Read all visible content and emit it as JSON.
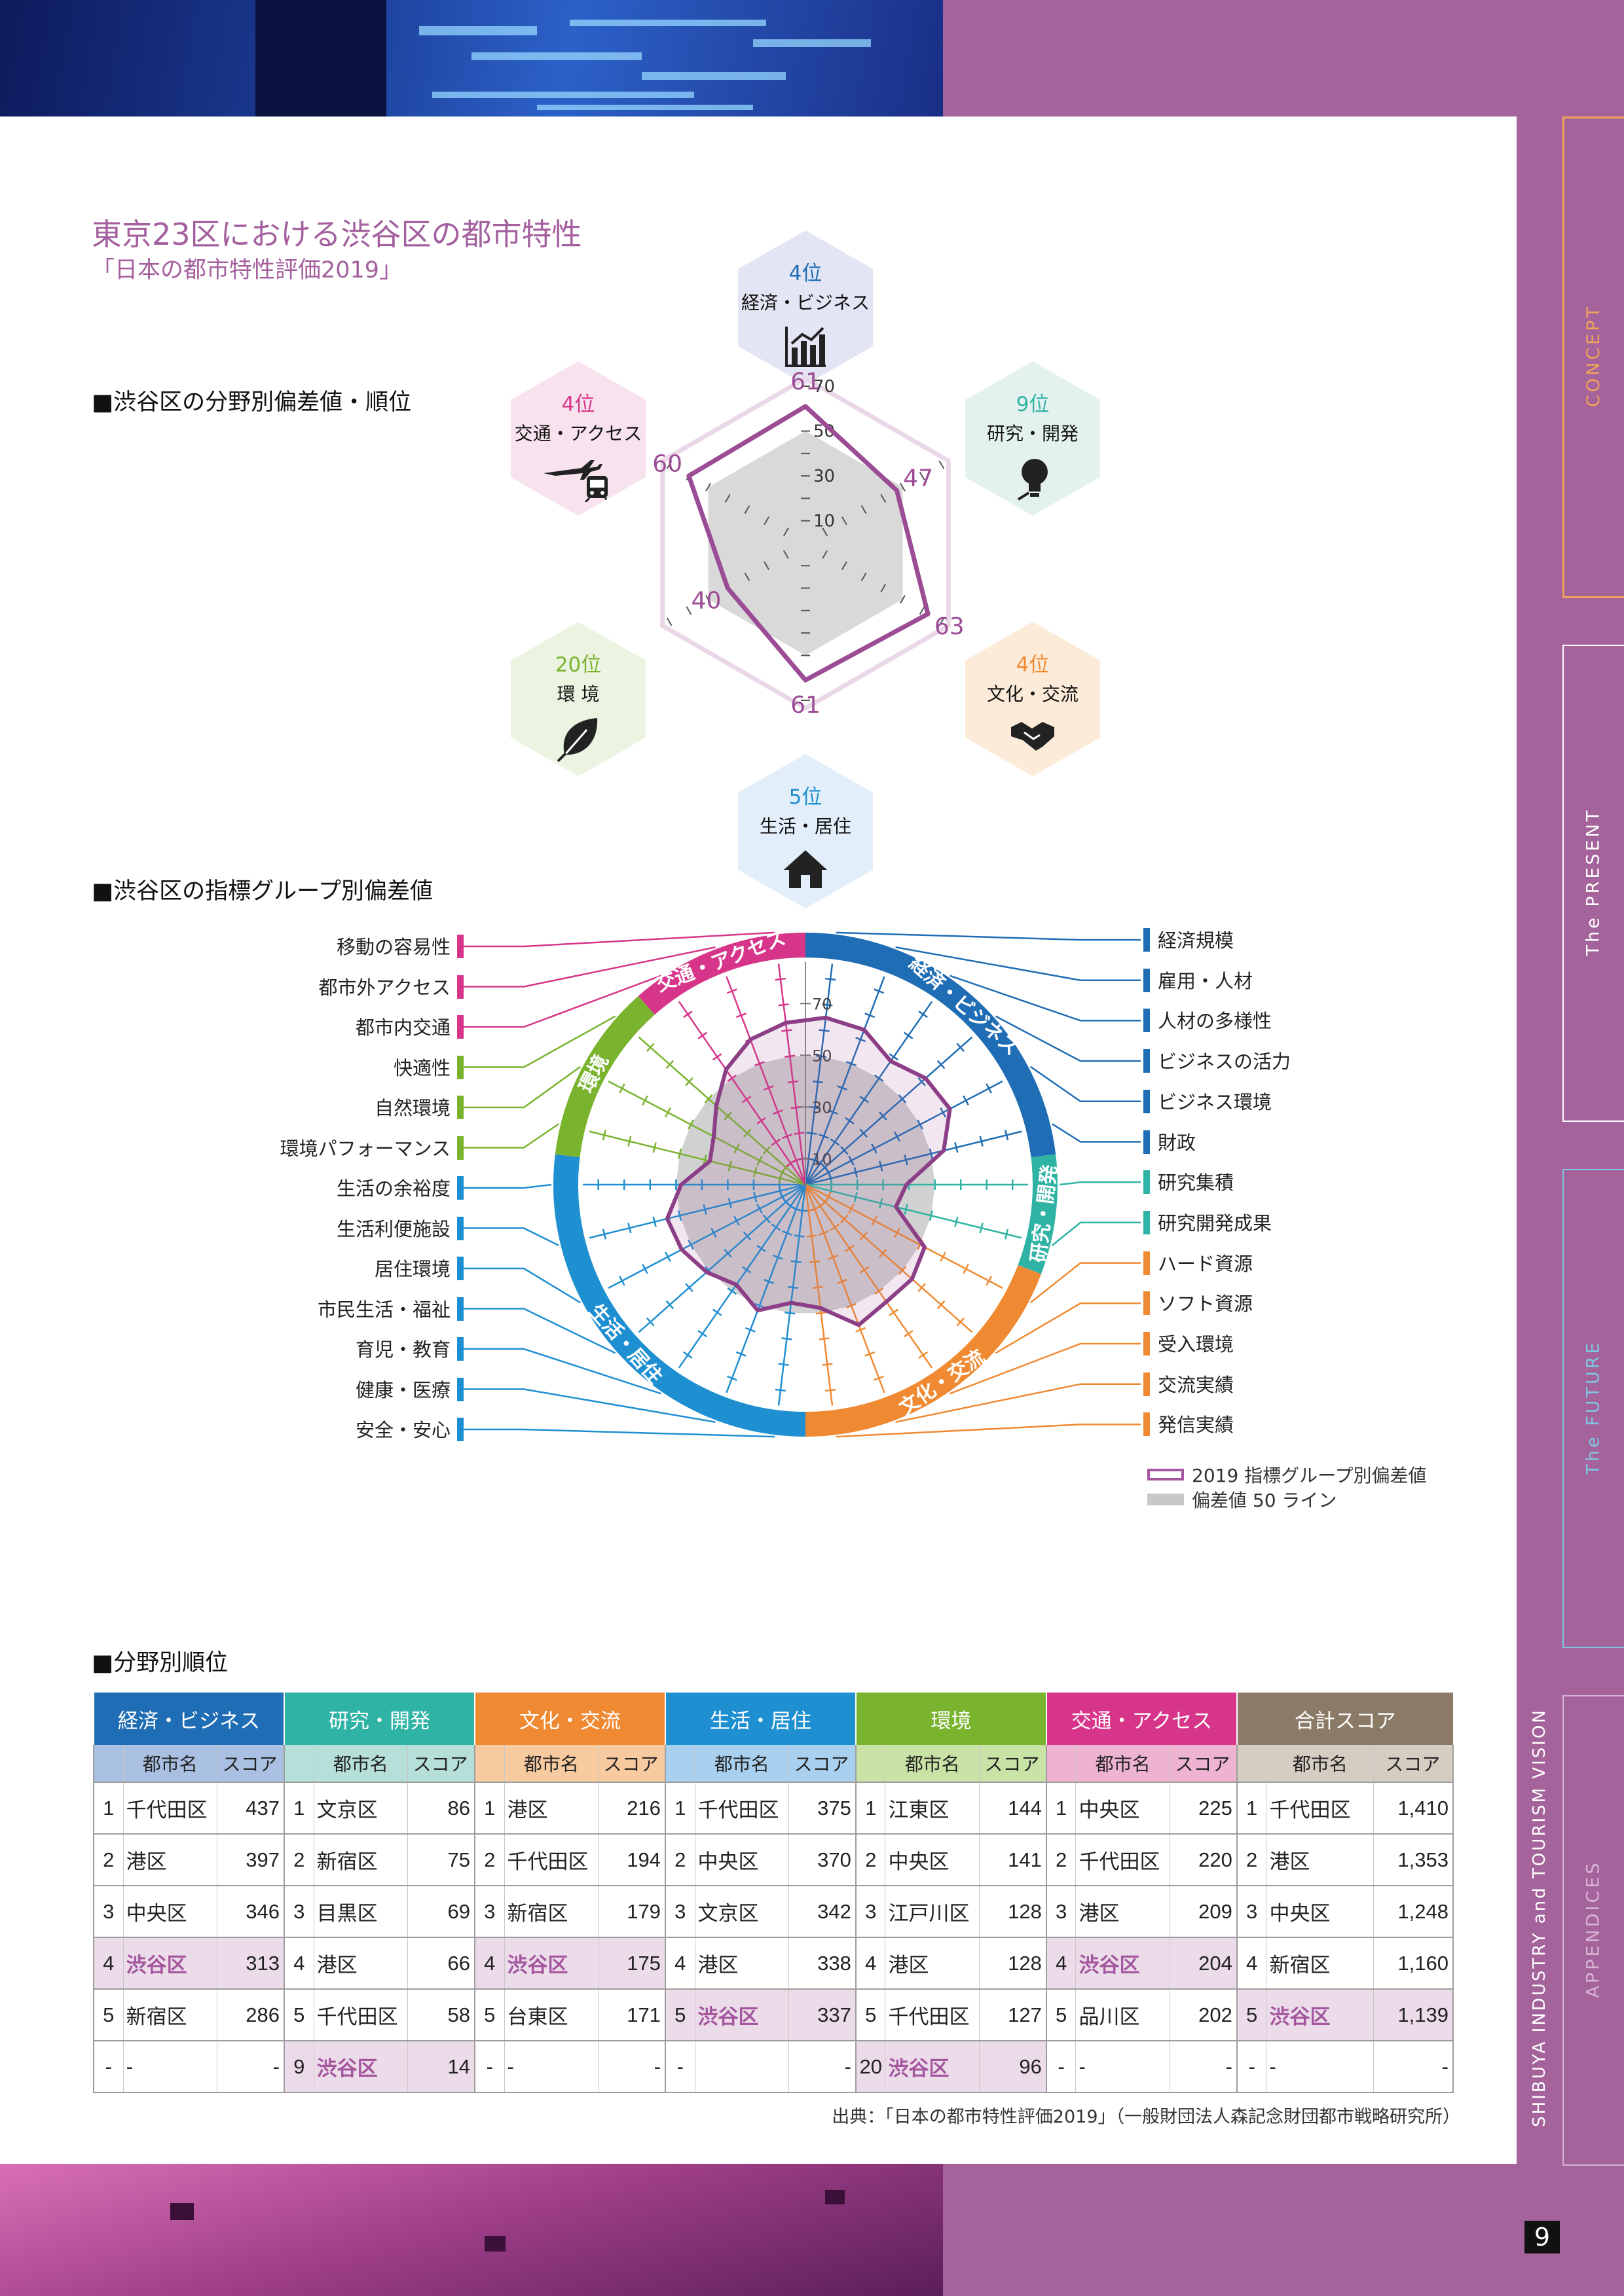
{
  "page": {
    "title": "東京23区における渋谷区の都市特性",
    "subtitle": "「日本の都市特性評価2019」",
    "page_number": "9",
    "vertical_text": "SHIBUYA INDUSTRY and TOURISM VISION",
    "source": "出典：「日本の都市特性評価2019」（一般財団法人森記念財団都市戦略研究所）"
  },
  "side_tabs": [
    {
      "label": "CONCEPT",
      "color": "#f0a35a"
    },
    {
      "label": "The PRESENT",
      "color": "#ffffff"
    },
    {
      "label": "The FUTURE",
      "color": "#7fc6e2"
    },
    {
      "label": "APPENDICES",
      "color": "#d8b4d4"
    }
  ],
  "section1": {
    "heading": "■渋谷区の分野別偏差値・順位",
    "categories": [
      {
        "rank": "4位",
        "label": "経済・ビジネス",
        "color": "#1f6db4",
        "bg": "#e4e5f4",
        "icon": "chart-icon"
      },
      {
        "rank": "9位",
        "label": "研究・開発",
        "color": "#2fb3a4",
        "bg": "#e4f2ef",
        "icon": "lightbulb-icon"
      },
      {
        "rank": "4位",
        "label": "文化・交流",
        "color": "#ef8a32",
        "bg": "#fdebd9",
        "icon": "handshake-icon"
      },
      {
        "rank": "5位",
        "label": "生活・居住",
        "color": "#1e8fd1",
        "bg": "#e2eef9",
        "icon": "house-icon"
      },
      {
        "rank": "20位",
        "label": "環 境",
        "color": "#7ab32e",
        "bg": "#ebf4e1",
        "icon": "leaf-icon"
      },
      {
        "rank": "4位",
        "label": "交通・アクセス",
        "color": "#d7358a",
        "bg": "#f7e2ed",
        "icon": "plane-train-icon"
      }
    ]
  },
  "chart_data": [
    {
      "type": "radar",
      "axes": [
        "経済・ビジネス",
        "研究・開発",
        "文化・交流",
        "生活・居住",
        "環 境",
        "交通・アクセス"
      ],
      "values": [
        61,
        47,
        63,
        61,
        40,
        60
      ],
      "ticks": [
        "10",
        "30",
        "50",
        "70"
      ],
      "value_labels": [
        "61",
        "47",
        "63",
        "61",
        "40",
        "60"
      ],
      "baseline": 50,
      "rmax": 70
    },
    {
      "type": "radar",
      "title": "■渋谷区の指標グループ別偏差値",
      "groups": [
        "経済・ビジネス",
        "研究・開発",
        "文化・交流",
        "生活・居住",
        "環境",
        "交通・アクセス"
      ],
      "axes": [
        "経済規模",
        "雇用・人材",
        "人材の多様性",
        "ビジネスの活力",
        "ビジネス環境",
        "財政",
        "研究集積",
        "研究開発成果",
        "ハード資源",
        "ソフト資源",
        "受入環境",
        "交流実績",
        "発信実績",
        "安全・安心",
        "健康・医療",
        "育児・教育",
        "市民生活・福祉",
        "居住環境",
        "生活利便施設",
        "生活の余裕度",
        "環境パフォーマンス",
        "自然環境",
        "快適性",
        "都市内交通",
        "都市外アクセス",
        "移動の容易性"
      ],
      "values": [
        65,
        64,
        58,
        62,
        63,
        55,
        39,
        36,
        52,
        55,
        55,
        58,
        48,
        46,
        52,
        47,
        51,
        54,
        55,
        48,
        38,
        40,
        46,
        54,
        60,
        63
      ],
      "ticks": [
        "10",
        "30",
        "50",
        "70"
      ],
      "baseline": 50,
      "legend": [
        "2019 指標グループ別偏差値",
        "偏差値 50 ライン"
      ]
    }
  ],
  "indicators_left": [
    {
      "label": "移動の容易性",
      "color": "#d7358a"
    },
    {
      "label": "都市外アクセス",
      "color": "#d7358a"
    },
    {
      "label": "都市内交通",
      "color": "#d7358a"
    },
    {
      "label": "快適性",
      "color": "#7ab32e"
    },
    {
      "label": "自然環境",
      "color": "#7ab32e"
    },
    {
      "label": "環境パフォーマンス",
      "color": "#7ab32e"
    },
    {
      "label": "生活の余裕度",
      "color": "#1e8fd1"
    },
    {
      "label": "生活利便施設",
      "color": "#1e8fd1"
    },
    {
      "label": "居住環境",
      "color": "#1e8fd1"
    },
    {
      "label": "市民生活・福祉",
      "color": "#1e8fd1"
    },
    {
      "label": "育児・教育",
      "color": "#1e8fd1"
    },
    {
      "label": "健康・医療",
      "color": "#1e8fd1"
    },
    {
      "label": "安全・安心",
      "color": "#1e8fd1"
    }
  ],
  "indicators_right": [
    {
      "label": "経済規模",
      "color": "#1f6db4"
    },
    {
      "label": "雇用・人材",
      "color": "#1f6db4"
    },
    {
      "label": "人材の多様性",
      "color": "#1f6db4"
    },
    {
      "label": "ビジネスの活力",
      "color": "#1f6db4"
    },
    {
      "label": "ビジネス環境",
      "color": "#1f6db4"
    },
    {
      "label": "財政",
      "color": "#1f6db4"
    },
    {
      "label": "研究集積",
      "color": "#2fb3a4"
    },
    {
      "label": "研究開発成果",
      "color": "#2fb3a4"
    },
    {
      "label": "ハード資源",
      "color": "#ef8a32"
    },
    {
      "label": "ソフト資源",
      "color": "#ef8a32"
    },
    {
      "label": "受入環境",
      "color": "#ef8a32"
    },
    {
      "label": "交流実績",
      "color": "#ef8a32"
    },
    {
      "label": "発信実績",
      "color": "#ef8a32"
    }
  ],
  "ring_groups": [
    {
      "label": "経済・ビジネス",
      "color": "#1f6db4"
    },
    {
      "label": "研究・開発",
      "color": "#2fb3a4"
    },
    {
      "label": "文化・交流",
      "color": "#ef8a32"
    },
    {
      "label": "生活・居住",
      "color": "#1e8fd1"
    },
    {
      "label": "環境",
      "color": "#7ab32e"
    },
    {
      "label": "交通・アクセス",
      "color": "#d7358a"
    }
  ],
  "table": {
    "heading": "■分野別順位",
    "col_city": "都市名",
    "col_score": "スコア",
    "columns": [
      {
        "title": "経済・ビジネス",
        "color": "#1f6db4",
        "sub_bg": "#a9c0e2"
      },
      {
        "title": "研究・開発",
        "color": "#2fb3a4",
        "sub_bg": "#b5dfd8"
      },
      {
        "title": "文化・交流",
        "color": "#ef8a32",
        "sub_bg": "#f8caa0"
      },
      {
        "title": "生活・居住",
        "color": "#1e8fd1",
        "sub_bg": "#a9d0ee"
      },
      {
        "title": "環境",
        "color": "#7ab32e",
        "sub_bg": "#c9e2a6"
      },
      {
        "title": "交通・アクセス",
        "color": "#d7358a",
        "sub_bg": "#eeb3d1"
      },
      {
        "title": "合計スコア",
        "color": "#8a7a66",
        "sub_bg": "#d6cdc2"
      }
    ],
    "rows": [
      [
        [
          "1",
          "千代田区",
          "437",
          false
        ],
        [
          "1",
          "文京区",
          "86",
          false
        ],
        [
          "1",
          "港区",
          "216",
          false
        ],
        [
          "1",
          "千代田区",
          "375",
          false
        ],
        [
          "1",
          "江東区",
          "144",
          false
        ],
        [
          "1",
          "中央区",
          "225",
          false
        ],
        [
          "1",
          "千代田区",
          "1,410",
          false
        ]
      ],
      [
        [
          "2",
          "港区",
          "397",
          false
        ],
        [
          "2",
          "新宿区",
          "75",
          false
        ],
        [
          "2",
          "千代田区",
          "194",
          false
        ],
        [
          "2",
          "中央区",
          "370",
          false
        ],
        [
          "2",
          "中央区",
          "141",
          false
        ],
        [
          "2",
          "千代田区",
          "220",
          false
        ],
        [
          "2",
          "港区",
          "1,353",
          false
        ]
      ],
      [
        [
          "3",
          "中央区",
          "346",
          false
        ],
        [
          "3",
          "目黒区",
          "69",
          false
        ],
        [
          "3",
          "新宿区",
          "179",
          false
        ],
        [
          "3",
          "文京区",
          "342",
          false
        ],
        [
          "3",
          "江戸川区",
          "128",
          false
        ],
        [
          "3",
          "港区",
          "209",
          false
        ],
        [
          "3",
          "中央区",
          "1,248",
          false
        ]
      ],
      [
        [
          "4",
          "渋谷区",
          "313",
          true
        ],
        [
          "4",
          "港区",
          "66",
          false
        ],
        [
          "4",
          "渋谷区",
          "175",
          true
        ],
        [
          "4",
          "港区",
          "338",
          false
        ],
        [
          "4",
          "港区",
          "128",
          false
        ],
        [
          "4",
          "渋谷区",
          "204",
          true
        ],
        [
          "4",
          "新宿区",
          "1,160",
          false
        ]
      ],
      [
        [
          "5",
          "新宿区",
          "286",
          false
        ],
        [
          "5",
          "千代田区",
          "58",
          false
        ],
        [
          "5",
          "台東区",
          "171",
          false
        ],
        [
          "5",
          "渋谷区",
          "337",
          true
        ],
        [
          "5",
          "千代田区",
          "127",
          false
        ],
        [
          "5",
          "品川区",
          "202",
          false
        ],
        [
          "5",
          "渋谷区",
          "1,139",
          true
        ]
      ],
      [
        [
          "-",
          "-",
          "-",
          false
        ],
        [
          "9",
          "渋谷区",
          "14",
          true
        ],
        [
          "-",
          "-",
          "-",
          false
        ],
        [
          "-",
          "",
          "-",
          false
        ],
        [
          "20",
          "渋谷区",
          "96",
          true
        ],
        [
          "-",
          "-",
          "-",
          false
        ],
        [
          "-",
          "-",
          "-",
          false
        ]
      ]
    ]
  }
}
